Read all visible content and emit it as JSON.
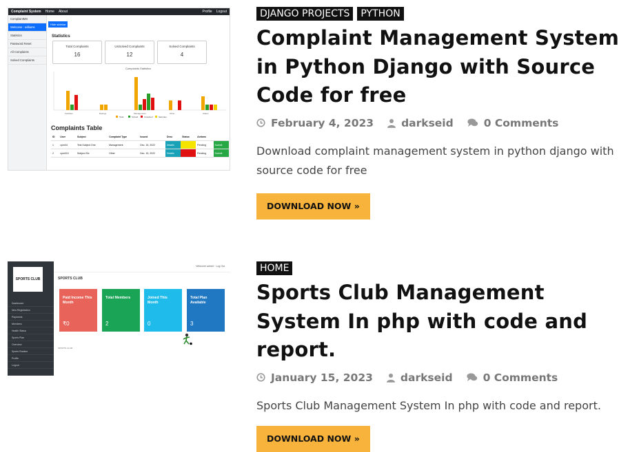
{
  "posts": [
    {
      "categories": [
        "DJANGO PROJECTS",
        "PYTHON"
      ],
      "title": "Complaint Management System in Python Django with Source Code for free",
      "date": "February 4, 2023",
      "author": "darkseid",
      "comments": "0 Comments",
      "excerpt": "Download complaint management system in python django with source code for free",
      "button": "DOWNLOAD NOW »",
      "thumbnail": {
        "nav_title": "Complaint System",
        "nav_links": [
          "Home",
          "About"
        ],
        "nav_right": [
          "Profile",
          "Logout"
        ],
        "brand": "ComplaintMS",
        "sidebar": [
          "Welcome : williams",
          "Statistics",
          "Password Reset",
          "All Complaints",
          "Solved Complaints"
        ],
        "hide_btn": "Hide sidebar",
        "stats_title": "Statistics",
        "cards": [
          {
            "label": "Total Complaints",
            "value": "16"
          },
          {
            "label": "UnSolved Complaints",
            "value": "12"
          },
          {
            "label": "Solved Complaints",
            "value": "4"
          }
        ],
        "chart_title": "Complaints Statistics",
        "legend": [
          "Total",
          "Solved",
          "Unsolved",
          "Sampleu"
        ],
        "categories": [
          "Facilities",
          "Ratings",
          "Management",
          "Other",
          "Status"
        ],
        "table_title": "Complaints Table",
        "table_headers": [
          "ID",
          "User",
          "Subject",
          "Complaint Type",
          "Issued",
          "Desc",
          "Status",
          "Actions"
        ],
        "table_rows": [
          [
            "1",
            "cpm04",
            "Test Subject One",
            "Management",
            "Dec. 15, 2022",
            "Details",
            "",
            "Pending",
            "Submit"
          ],
          [
            "2",
            "cpm010",
            "Subject Six",
            "Other",
            "Dec. 15, 2022",
            "Details",
            "",
            "Pending",
            "Submit"
          ]
        ]
      }
    },
    {
      "categories": [
        "HOME"
      ],
      "title": "Sports Club Management System In php with code and report.",
      "date": "January 15, 2023",
      "author": "darkseid",
      "comments": "0 Comments",
      "excerpt": "Sports Club Management System In php with code and report.",
      "button": "DOWNLOAD NOW »",
      "thumbnail": {
        "logo": "SPORTS CLUB",
        "header_right": "Welcome admin! · Log Out",
        "page_title": "SPORTS CLUB",
        "sidebar": [
          "Dashboard",
          "New Registration",
          "Payments",
          "Members",
          "Health Status",
          "Sports Plan",
          "Overview",
          "Sports Routine",
          "Profile",
          "Logout"
        ],
        "tiles": [
          {
            "label": "Paid Income This Month",
            "value": "₹0",
            "color": "#e8645a"
          },
          {
            "label": "Total Members",
            "value": "2",
            "color": "#1aa556"
          },
          {
            "label": "Joined This Month",
            "value": "0",
            "color": "#1fbbeb"
          },
          {
            "label": "Total Plan Available",
            "value": "3",
            "color": "#1f78c1"
          }
        ],
        "footer": "SPORTS CLUB"
      }
    }
  ],
  "colors": {
    "accent": "#f7b33b",
    "category_bg": "#111111",
    "meta": "#777777"
  }
}
